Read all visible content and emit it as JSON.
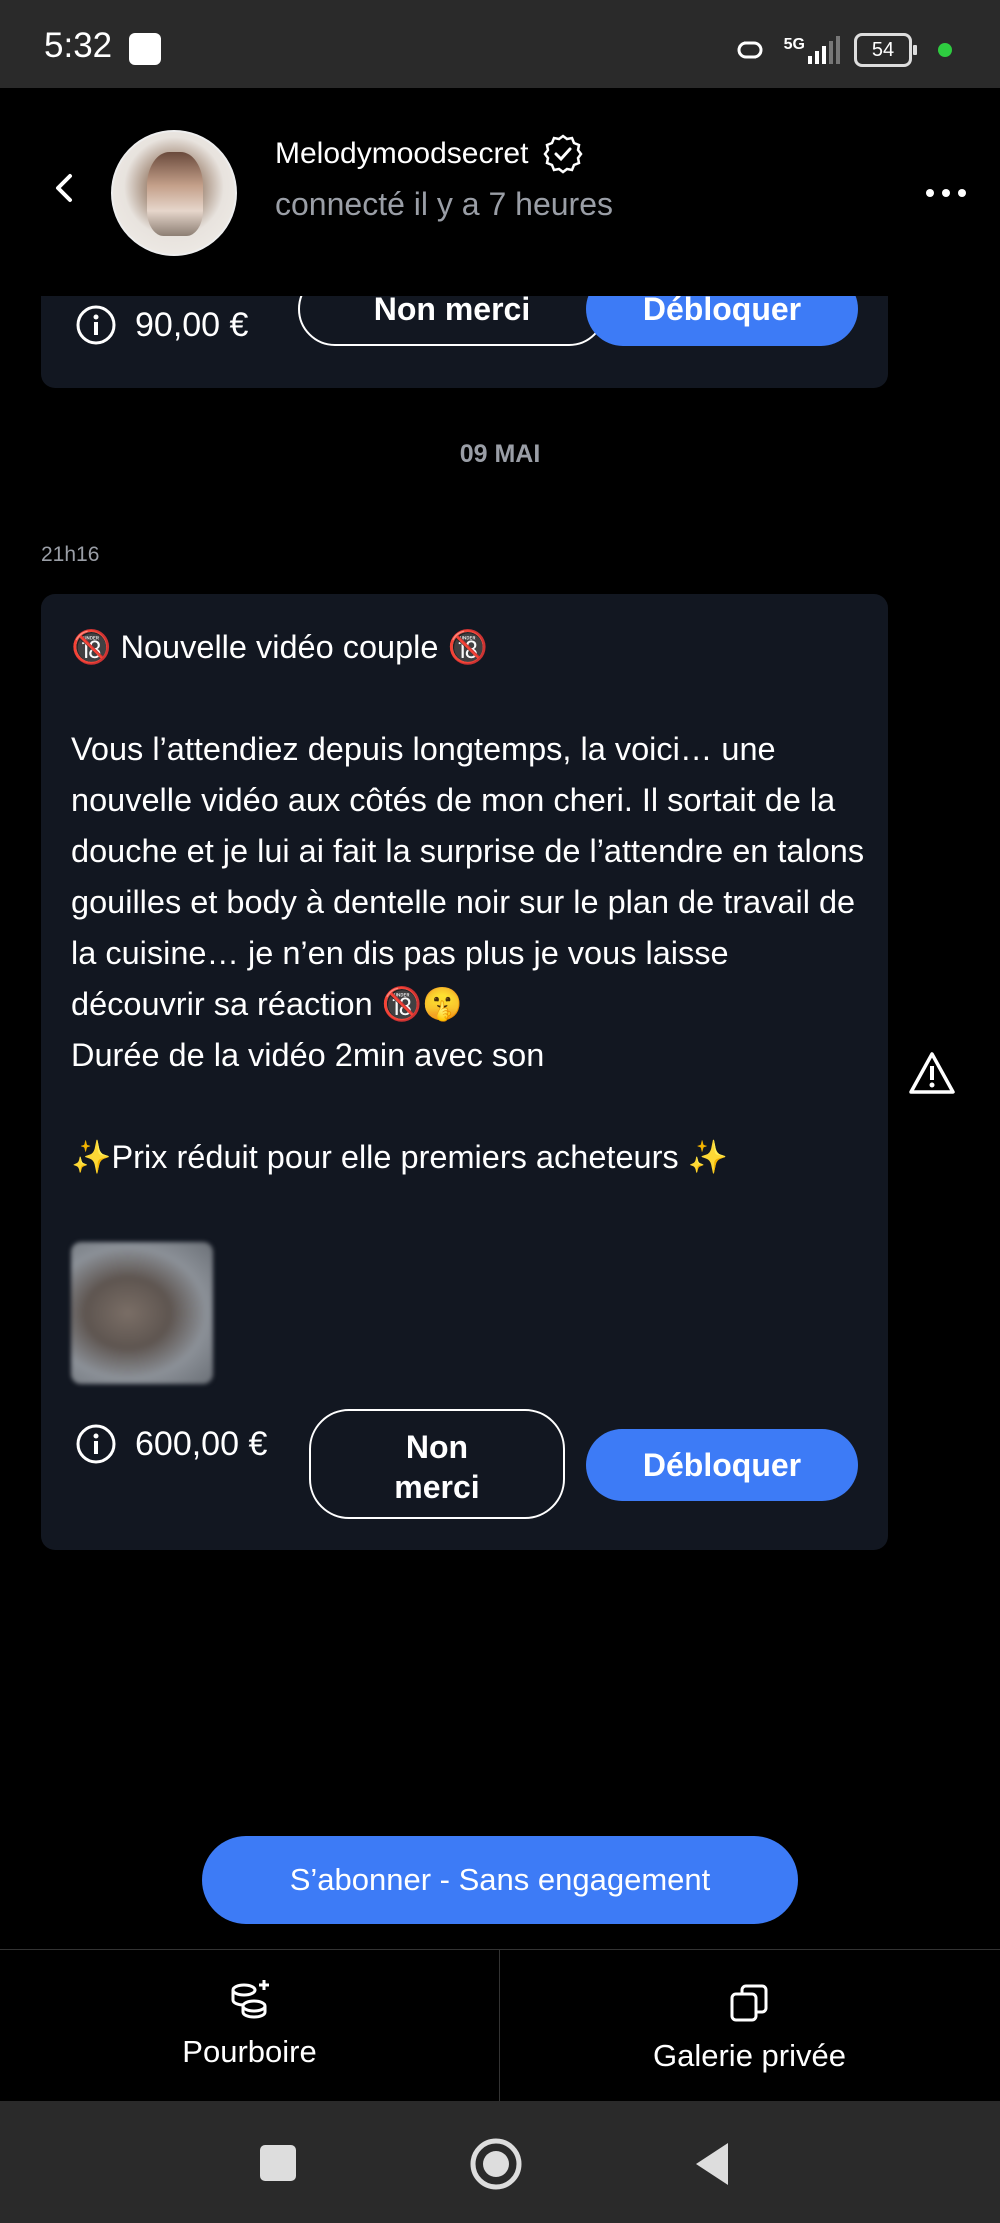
{
  "status_bar": {
    "time": "5:32",
    "network": "5G",
    "battery": "54"
  },
  "header": {
    "creator_name": "Melodymoodsecret",
    "last_seen": "connecté il y a 7 heures",
    "icons": [
      "back-arrow-icon",
      "verified-badge-icon",
      "more-dots-icon"
    ]
  },
  "messages": {
    "first": {
      "price": "90,00 €",
      "decline_label": "Non merci",
      "unlock_label": "Débloquer"
    },
    "date_separator": "09 MAI",
    "second": {
      "time": "21h16",
      "text": "🔞 Nouvelle vidéo couple 🔞\n\nVous l’attendiez depuis longtemps, la voici… une nouvelle vidéo aux côtés de mon cheri. Il sortait de la douche et je lui ai fait la surprise de l’attendre en talons gouilles et body à dentelle noir sur le plan de travail de la cuisine… je n’en dis pas plus je vous laisse découvrir sa réaction 🔞🤫\nDurée de la vidéo 2min avec son\n\n✨Prix réduit pour elle premiers acheteurs ✨",
      "price": "600,00 €",
      "decline_label_line1": "Non",
      "decline_label_line2": "merci",
      "unlock_label": "Débloquer"
    }
  },
  "actions": {
    "subscribe_label": "S’abonner - Sans engagement"
  },
  "bottom_nav": {
    "tip_label": "Pourboire",
    "gallery_label": "Galerie privée"
  },
  "colors": {
    "accent": "#3d7bf6",
    "card_bg": "#121721",
    "muted_text": "#9a9ea6",
    "status_dot": "#2ecc40"
  }
}
